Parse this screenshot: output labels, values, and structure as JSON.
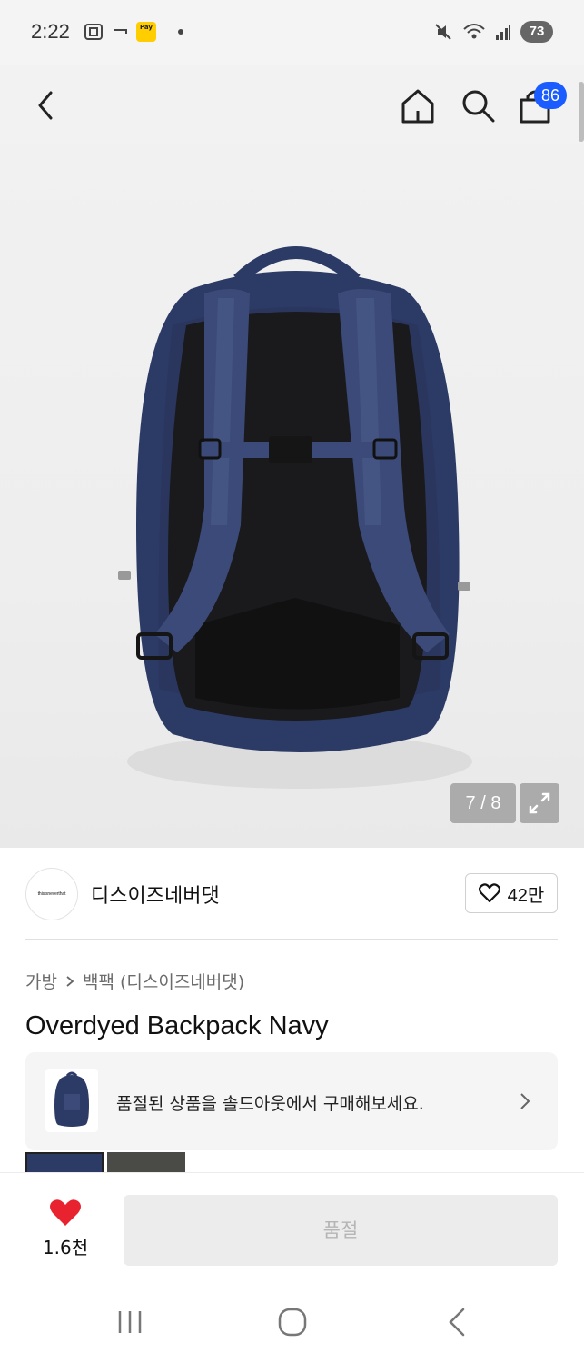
{
  "status_bar": {
    "time": "2:22",
    "pay_label": "Pay",
    "battery": "73"
  },
  "nav": {
    "cart_count": "86"
  },
  "gallery": {
    "counter": "7 / 8"
  },
  "brand": {
    "logo_text": "thisisneverthat",
    "name": "디스이즈네버댓",
    "like_count": "42만"
  },
  "product": {
    "breadcrumb": [
      "가방",
      "백팩 (디스이즈네버댓)"
    ],
    "title": "Overdyed Backpack Navy"
  },
  "soldout_banner": {
    "text": "품절된 상품을 솔드아웃에서 구매해보세요."
  },
  "bottom_bar": {
    "wish_count": "1.6천",
    "buy_label": "품절"
  },
  "colors": {
    "accent_blue": "#1a5cff",
    "heart_red": "#e8222e",
    "backpack_navy": "#2c3a66"
  }
}
